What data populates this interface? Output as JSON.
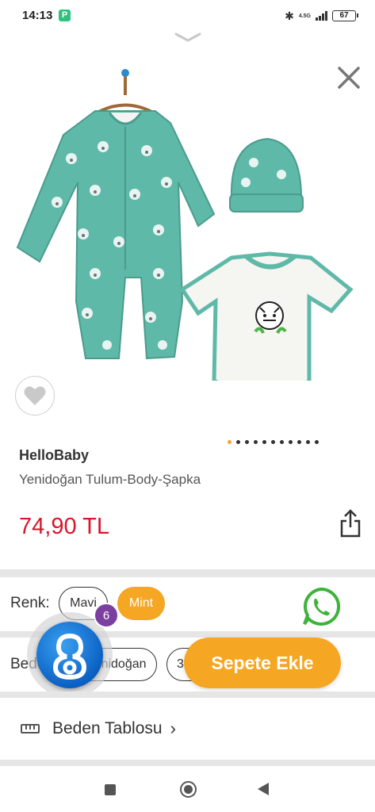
{
  "status_bar": {
    "time": "14:13",
    "app_icon": "P",
    "network": "4.5G",
    "battery": "67"
  },
  "product": {
    "brand": "HelloBaby",
    "name": "Yenidoğan Tulum-Body-Şapka",
    "price": "74,90 TL",
    "image_count": 11,
    "active_image_index": 0
  },
  "options": {
    "color_label": "Renk:",
    "colors": [
      "Mavi",
      "Mint"
    ],
    "selected_color": "Mint",
    "size_label": "Beden:",
    "sizes": [
      "Yenidoğan",
      "3-6 Ay"
    ]
  },
  "actions": {
    "add_to_cart": "Sepete Ekle",
    "size_chart": "Beden Tablosu"
  },
  "bubble": {
    "badge_count": "6"
  },
  "colors": {
    "accent": "#f5a623",
    "price": "#d9152b",
    "mint": "#5fb9a8",
    "whatsapp": "#3db33a"
  },
  "icons": [
    "bluetooth-icon",
    "signal-icon",
    "battery-icon",
    "collapse-chevron-icon",
    "close-icon",
    "heart-icon",
    "share-icon",
    "whatsapp-icon",
    "ruler-icon",
    "chevron-right-icon"
  ]
}
